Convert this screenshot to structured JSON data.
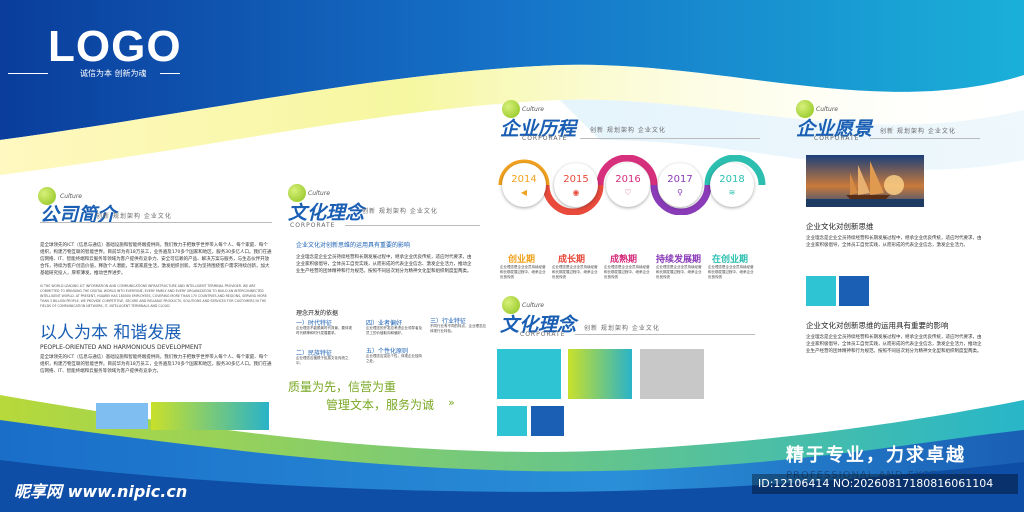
{
  "header": {
    "logo": "LOGO",
    "slogan": "诚信为本 创新为魂"
  },
  "common": {
    "culture_word": "Culture",
    "corporate_word": "CORPORATE",
    "sub_line": "创新 规划架构 企业文化"
  },
  "profile": {
    "title": "公司简介",
    "para1": "是全球领先的ICT（信息与通信）基础设施和智能终端提供商，我们致力于把数字世界带入每个人、每个家庭、每个组织，构建万物互联的智能世界。目前华为有18万员工，业务遍及170多个国家和地区，服务30多亿人口。我们在通信网络、IT、智能终端和云服务等领域为客户提供有竞争力、安全可信赖的产品、解决方案与服务，与生态伙伴开放合作，持续为客户创造价值，释放个人潜能，丰富家庭生活，激发组织创新。华为坚持围绕客户需求持续创新，加大基础研究投入，厚积薄发，推动世界进步。",
    "para1_en": "IS THE WORLD LEADING ICT INFORMATION AND COMMUNICATIONS INFRASTRUCTURE AND INTELLIGENT TERMINAL PROVIDER. WE ARE COMMITTED TO BRINGING THE DIGITAL WORLD INTO EVERYONE, EVERY FAMILY AND EVERY ORGANIZATION TO BUILD AN INTERCONNECTED INTELLIGENT WORLD. AT PRESENT, HUAWEI HAS 180000 EMPLOYEES, COVERING MORE THAN 170 COUNTRIES AND REGIONS, SERVING MORE THAN 3 BILLION PEOPLE. WE PROVIDE COMPETITIVE, SECURE AND RELIABLE PRODUCTS, SOLUTIONS AND SERVICES FOR CUSTOMERS IN THE FIELDS OF COMMUNICATION NETWORK, IT, INTELLIGENT TERMINALS AND CLOUD",
    "motto": "以人为本 和谐发展",
    "motto_en": "PEOPLE-ORIENTED AND HARMONIOUS DEVELOPMENT",
    "para2": "是全球领先的ICT（信息与通信）基础设施和智能终端提供商，我们致力于把数字世界带入每个人、每个家庭、每个组织，构建万物互联的智能世界。目前华为有18万员工，业务遍及170多个国家和地区，服务30多亿人口。我们在通信网络、IT、智能终端和云服务等领域为客户提供有竞争力。"
  },
  "culture1": {
    "title": "文化理念",
    "subtitle": "企业文化对创新思维的运用具有重要的影响",
    "para": "企业理念是企业全员持续经营和长期发展过程中，继承企业优良传统，适应时代要求，由企业家积极倡导，全体员工自觉实践，从而形成的代表企业信念、激发企业活力，推动企业生产经营的团体精神和行为规范。按照不同层次划分为精神文化型和组织制度型两类。",
    "principles_head": "理念开发的依据",
    "items": [
      {
        "label": "一）时代特征",
        "text": "企业理念不能脱离时代背景，要体现时代精神和时代发展要求。"
      },
      {
        "label": "四）业者偏好",
        "text": "企业理念的开发应考虑企业领导者及员工的价值取向和偏好。"
      },
      {
        "label": "三）行业特征",
        "text": "不同行业有不同的特点，企业理念应体现行业特色。"
      },
      {
        "label": "二）民族特征",
        "text": "企业理念应植根于民族文化传统之中。"
      },
      {
        "label": "五）个性化原则",
        "text": "企业理念应突出个性，体现企业独特之处。"
      }
    ],
    "quote1": "质量为先，信营为重",
    "quote2": "管理文本，服务为诚"
  },
  "history": {
    "title": "企业历程",
    "milestones": [
      {
        "year": "2014",
        "stage": "创业期",
        "color": "#f2a21f",
        "icon": "megaphone-icon",
        "glyph": "◀",
        "desc": "企业理念是企业全员持续经营和长期发展过程中，继承企业优良传统"
      },
      {
        "year": "2015",
        "stage": "成长期",
        "color": "#e84a3c",
        "icon": "eye-icon",
        "glyph": "◉",
        "desc": "企业理念是企业全员持续经营和长期发展过程中，继承企业优良传统"
      },
      {
        "year": "2016",
        "stage": "成熟期",
        "color": "#d62f7c",
        "icon": "heart-icon",
        "glyph": "♡",
        "desc": "企业理念是企业全员持续经营和长期发展过程中，继承企业优良传统"
      },
      {
        "year": "2017",
        "stage": "持续发展期",
        "color": "#8a3bb8",
        "icon": "search-icon",
        "glyph": "⚲",
        "desc": "企业理念是企业全员持续经营和长期发展过程中，继承企业优良传统"
      },
      {
        "year": "2018",
        "stage": "在创业期",
        "color": "#2cbfb0",
        "icon": "wifi-icon",
        "glyph": "≋",
        "desc": "企业理念是企业全员持续经营和长期发展过程中，继承企业优良传统"
      }
    ]
  },
  "culture2": {
    "title": "文化理念"
  },
  "vision": {
    "title": "企业愿景",
    "subtitle1": "企业文化对创新思维",
    "para1": "企业理念是企业全员持续经营和长期发展过程中，继承企业优良传统，适应时代要求，由企业家积极倡导，全体员工自觉实践，从而形成的代表企业信念，激发企业活力。",
    "subtitle2": "企业文化对创新思维的运用具有重要的影响",
    "para2": "企业理念是企业全员持续经营和长期发展过程中，继承企业优良传统，适应时代要求，由企业家积极倡导，全体员工自觉实践，从而形成的代表企业信念，激发企业活力，推动企业生产经营的团体精神和行为规范。按照不同层次划分为精神文化型和组织制度型两类。"
  },
  "footer": {
    "slogan": "精于专业，力求卓越",
    "slogan_en": "PROFESSIONAL AND EXCELLENT",
    "watermark": "昵享网 www.nipic.cn",
    "id": "ID:12106414 NO:20260817180816061104"
  },
  "colors": {
    "primary": "#1a5fb4",
    "green": "#8cc21a",
    "teal": "#1ab0c8"
  }
}
